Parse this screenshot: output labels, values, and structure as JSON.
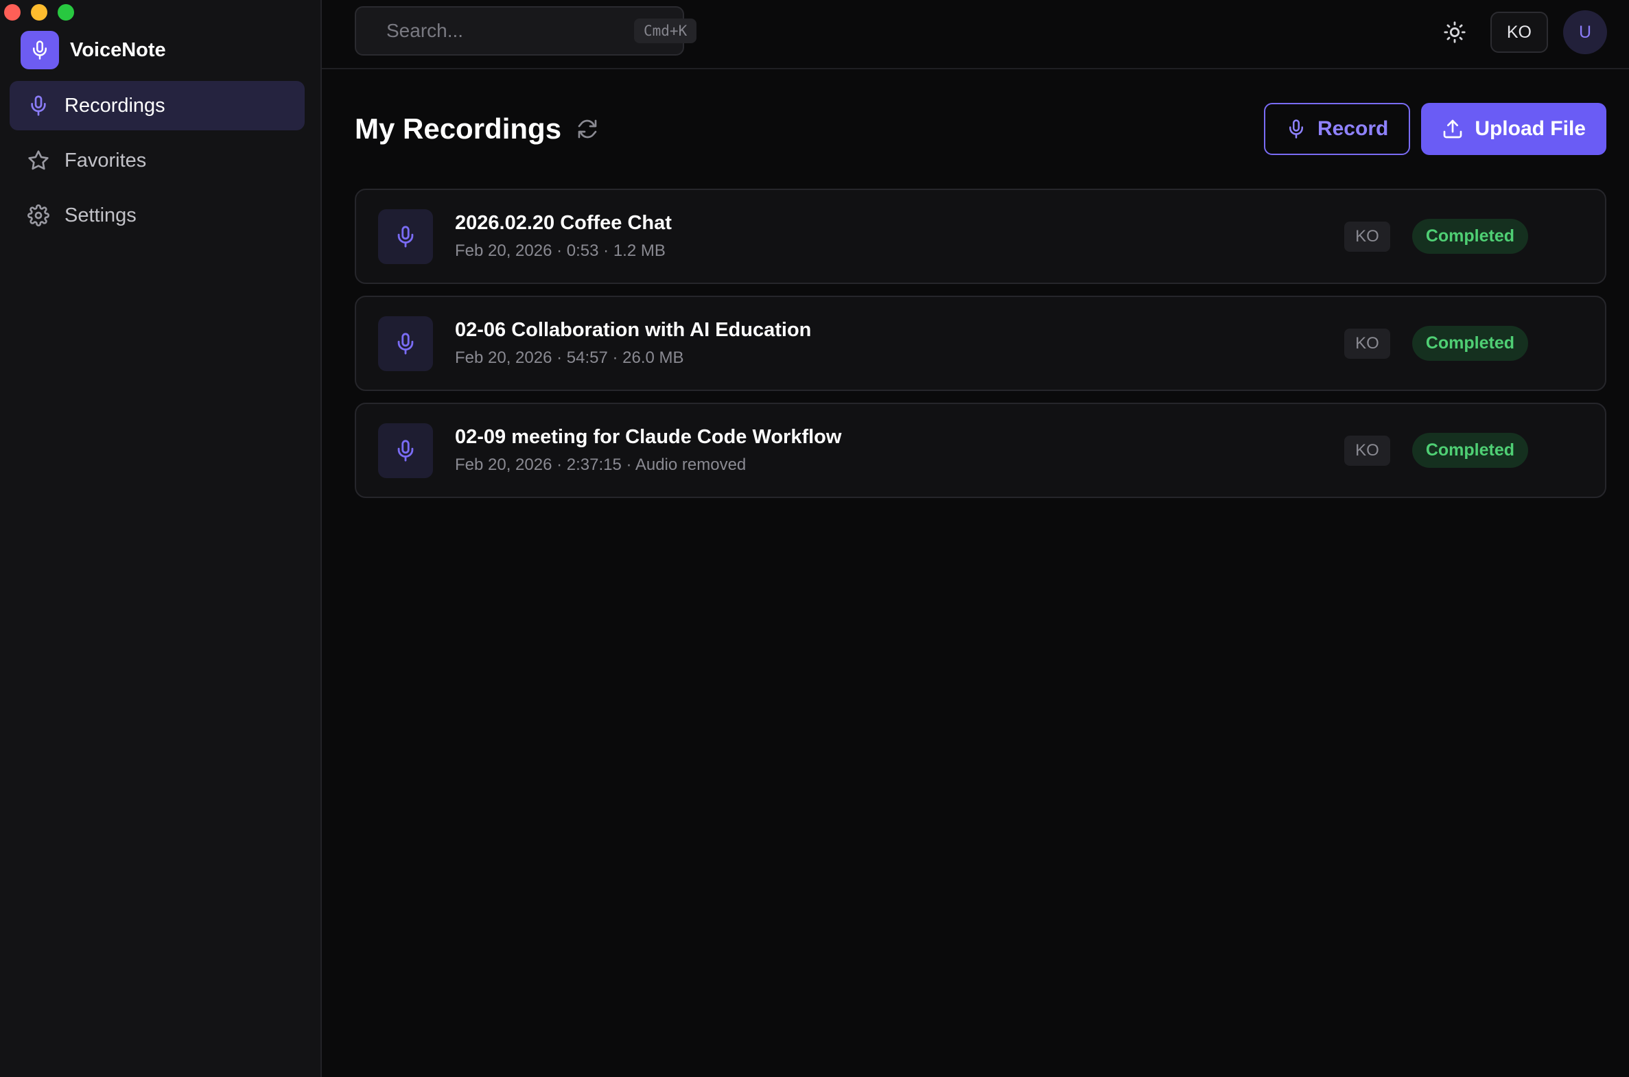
{
  "app": {
    "name": "VoiceNote",
    "accent": "#6a5cf5"
  },
  "sidebar": {
    "items": [
      {
        "label": "Recordings",
        "icon": "mic-icon",
        "active": true
      },
      {
        "label": "Favorites",
        "icon": "star-icon",
        "active": false
      },
      {
        "label": "Settings",
        "icon": "gear-icon",
        "active": false
      }
    ]
  },
  "topbar": {
    "search_placeholder": "Search...",
    "search_shortcut": "Cmd+K",
    "theme_icon": "sun-icon",
    "language": "KO",
    "avatar_initial": "U"
  },
  "main": {
    "title": "My Recordings",
    "record_label": "Record",
    "upload_label": "Upload File"
  },
  "recordings": [
    {
      "title": "2026.02.20 Coffee Chat",
      "meta": "Feb 20, 2026 · 0:53 · 1.2 MB",
      "language": "KO",
      "status": "Completed"
    },
    {
      "title": "02-06 Collaboration with AI Education",
      "meta": "Feb 20, 2026 · 54:57 · 26.0 MB",
      "language": "KO",
      "status": "Completed"
    },
    {
      "title": "02-09 meeting for Claude Code Workflow",
      "meta": "Feb 20, 2026 · 2:37:15 · Audio removed",
      "language": "KO",
      "status": "Completed"
    }
  ]
}
